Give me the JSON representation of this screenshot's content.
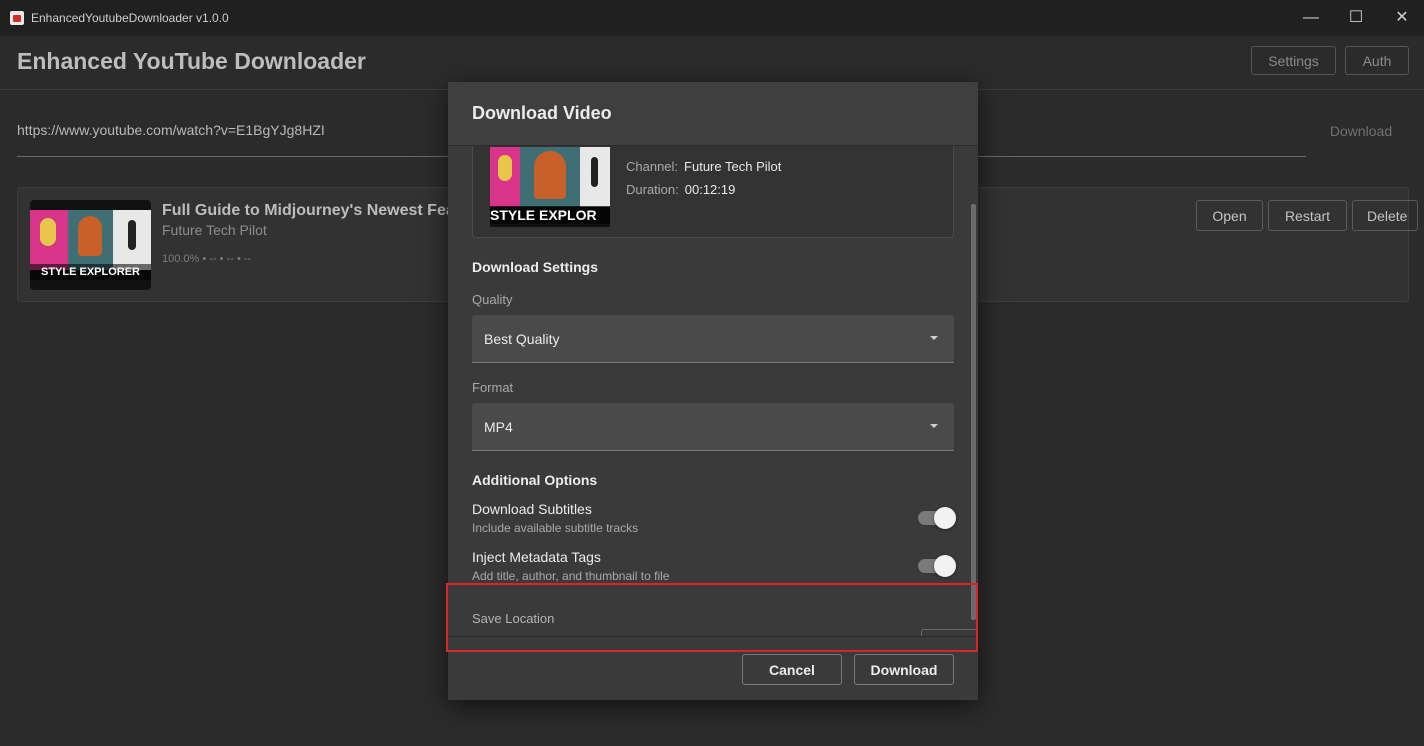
{
  "window": {
    "title": "EnhancedYoutubeDownloader v1.0.0",
    "minimize": "—",
    "maximize": "☐",
    "close": "✕"
  },
  "header": {
    "app_title": "Enhanced YouTube Downloader",
    "settings_label": "Settings",
    "auth_label": "Auth"
  },
  "url_bar": {
    "value": "https://www.youtube.com/watch?v=E1BgYJg8HZI",
    "download_label": "Download"
  },
  "download_item": {
    "thumbnail_text": "STYLE EXPLORER",
    "title": "Full Guide to Midjourney's Newest Featu",
    "channel": "Future Tech Pilot",
    "progress": "100.0% • -- • -- • --",
    "open_label": "Open",
    "restart_label": "Restart",
    "delete_label": "Delete"
  },
  "dialog": {
    "title": "Download Video",
    "video": {
      "thumbnail_text": "STYLE EXPLOR",
      "channel_key": "Channel:",
      "channel_value": "Future Tech Pilot",
      "duration_key": "Duration:",
      "duration_value": "00:12:19"
    },
    "settings_title": "Download Settings",
    "quality_label": "Quality",
    "quality_value": "Best Quality",
    "format_label": "Format",
    "format_value": "MP4",
    "additional_title": "Additional Options",
    "subtitles_title": "Download Subtitles",
    "subtitles_desc": "Include available subtitle tracks",
    "subtitles_enabled": true,
    "metadata_title": "Inject Metadata Tags",
    "metadata_desc": "Add title, author, and thumbnail to file",
    "metadata_enabled": true,
    "save_location_label": "Save Location",
    "cancel_label": "Cancel",
    "download_label": "Download"
  },
  "colors": {
    "highlight": "#d42828",
    "background": "#2b2b2b",
    "dialog": "#3a3a3a"
  }
}
